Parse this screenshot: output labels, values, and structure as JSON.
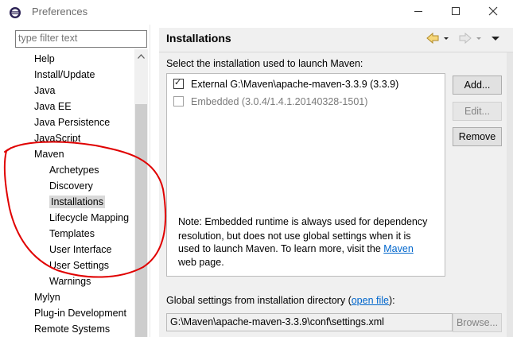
{
  "window": {
    "title": "Preferences",
    "controls": [
      "minimize",
      "maximize",
      "close"
    ]
  },
  "sidebar": {
    "filter_placeholder": "type filter text",
    "items": [
      {
        "label": "Help",
        "level": 0
      },
      {
        "label": "Install/Update",
        "level": 0
      },
      {
        "label": "Java",
        "level": 0
      },
      {
        "label": "Java EE",
        "level": 0
      },
      {
        "label": "Java Persistence",
        "level": 0
      },
      {
        "label": "JavaScript",
        "level": 0
      },
      {
        "label": "Maven",
        "level": 0
      },
      {
        "label": "Archetypes",
        "level": 1
      },
      {
        "label": "Discovery",
        "level": 1
      },
      {
        "label": "Installations",
        "level": 1,
        "selected": true
      },
      {
        "label": "Lifecycle Mapping",
        "level": 1
      },
      {
        "label": "Templates",
        "level": 1
      },
      {
        "label": "User Interface",
        "level": 1
      },
      {
        "label": "User Settings",
        "level": 1
      },
      {
        "label": "Warnings",
        "level": 1
      },
      {
        "label": "Mylyn",
        "level": 0
      },
      {
        "label": "Plug-in Development",
        "level": 0
      },
      {
        "label": "Remote Systems",
        "level": 0
      }
    ]
  },
  "page": {
    "title": "Installations",
    "nav_icons": [
      "back-arrow-icon",
      "forward-arrow-icon",
      "view-menu-icon"
    ],
    "intro": "Select the installation used to launch Maven:",
    "installations": [
      {
        "label": "External G:\\Maven\\apache-maven-3.3.9 (3.3.9)",
        "checked": true,
        "enabled": true
      },
      {
        "label": "Embedded (3.0.4/1.4.1.20140328-1501)",
        "checked": false,
        "enabled": false
      }
    ],
    "buttons": {
      "add": "Add...",
      "edit": "Edit...",
      "remove": "Remove",
      "browse": "Browse..."
    },
    "note_line1": "Note: Embedded runtime is always used for dependency",
    "note_line2": "resolution, but does not use global settings when it is",
    "note_line3_prefix": "used to launch Maven. To learn more, visit the ",
    "note_link": "Maven",
    "note_line4": "web page.",
    "global_prefix": "Global settings from installation directory (",
    "global_link": "open file",
    "global_suffix": "):",
    "global_path": "G:\\Maven\\apache-maven-3.3.9\\conf\\settings.xml"
  },
  "colors": {
    "annotation": "#e00000",
    "link": "#0066cc",
    "selection": "#d9d9d9"
  }
}
